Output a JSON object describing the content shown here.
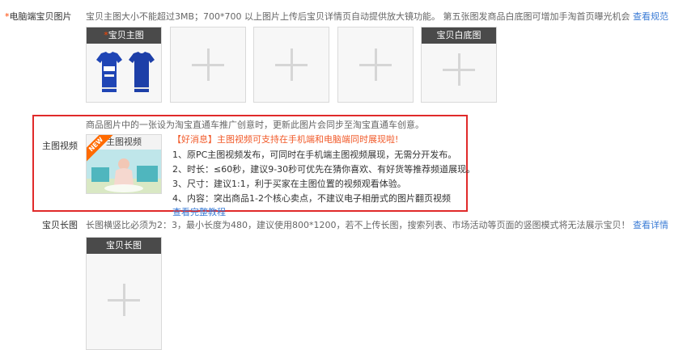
{
  "pc_images": {
    "required_mark": "*",
    "label": "电脑端宝贝图片",
    "hint": "宝贝主图大小不能超过3MB；700*700 以上图片上传后宝贝详情页自动提供放大镜功能。 第五张图发商品白底图可增加手淘首页曝光机会",
    "hint_link": "查看规范",
    "main_image_header": "宝贝主图",
    "white_bg_header": "宝贝白底图",
    "caption": "商品图片中的一张设为淘宝直通车推广创意时，更新此图片会同步至淘宝直通车创意。"
  },
  "video": {
    "label": "主图视频",
    "thumb_header": "主图视频",
    "new_badge": "NEW",
    "news": "【好消息】主图视频可支持在手机端和电脑端同时展现啦!",
    "items": [
      "1、原PC主图视频发布，可同时在手机端主图视频展现，无需分开发布。",
      "2、时长：≤60秒，建议9-30秒可优先在猜你喜欢、有好货等推荐频道展现。",
      "3、尺寸：建议1:1，利于买家在主图位置的视频观看体验。",
      "4、内容：突出商品1-2个核心卖点，不建议电子相册式的图片翻页视频"
    ],
    "tutorial_link": "查看完整教程"
  },
  "long_image": {
    "label": "宝贝长图",
    "hint": "长图横竖比必须为2：3，最小长度为480，建议使用800*1200，若不上传长图，搜索列表、市场活动等页面的竖图模式将无法展示宝贝！",
    "hint_link": "查看详情",
    "slot_header": "宝贝长图"
  },
  "colors": {
    "required": "#ff4400",
    "link": "#3a7bd5",
    "red_border": "#e02a2a",
    "news": "#f15a2a",
    "slot_header_bg": "#4a4a4a"
  }
}
